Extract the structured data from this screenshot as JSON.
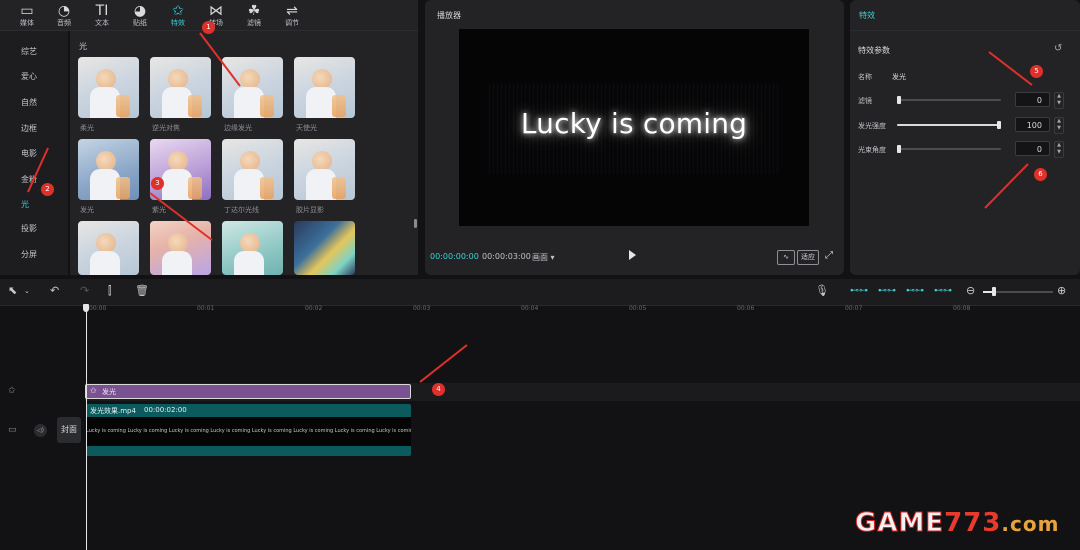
{
  "toolbar": {
    "items": [
      {
        "label": "媒体",
        "icon": "▭"
      },
      {
        "label": "音频",
        "icon": "◔"
      },
      {
        "label": "文本",
        "icon": "TI"
      },
      {
        "label": "贴纸",
        "icon": "◕"
      },
      {
        "label": "特效",
        "icon": "✩"
      },
      {
        "label": "转场",
        "icon": "⋈"
      },
      {
        "label": "滤镜",
        "icon": "☘"
      },
      {
        "label": "调节",
        "icon": "⇌"
      }
    ]
  },
  "sidebar": {
    "items": [
      "综艺",
      "爱心",
      "自然",
      "边框",
      "电影",
      "金粉",
      "光",
      "投影",
      "分屏"
    ]
  },
  "effects": {
    "section_title": "光",
    "items": [
      "柔光",
      "逆光对焦",
      "边缘发光",
      "天使光",
      "发光",
      "紫光",
      "丁达尔光线",
      "胶片显影"
    ]
  },
  "player": {
    "title": "播放器",
    "caption": "Lucky is coming",
    "current_time": "00:00:00:00",
    "total_time": "00:00:03:00",
    "ratio_label": "画面",
    "original_label": "适应"
  },
  "props": {
    "header": "特效",
    "section_title": "特效参数",
    "name_label": "名称",
    "name_value": "发光",
    "params": [
      {
        "label": "滤镜",
        "value": "0",
        "level": 0
      },
      {
        "label": "发光强度",
        "value": "100",
        "level": 1
      },
      {
        "label": "光束角度",
        "value": "0",
        "level": 0
      }
    ]
  },
  "timeline": {
    "ticks": [
      "00:00",
      "00:01",
      "00:02",
      "00:03",
      "00:04",
      "00:05",
      "00:06",
      "00:07",
      "00:08"
    ],
    "fx_clip_label": "发光",
    "video_clip_name": "发光效果.mp4",
    "video_clip_duration": "00:00:02:00",
    "video_strip_text": "Lucky is coming Lucky is coming Lucky is coming Lucky is coming Lucky is coming Lucky is coming Lucky is coming Lucky is coming Lucky is coming Lucky is coming Lucky is coming",
    "cover_label": "封面"
  },
  "annotations": [
    "1",
    "2",
    "3",
    "4",
    "5",
    "6"
  ],
  "watermark": {
    "brand": "GAME",
    "digits": "773",
    "domain": ".com"
  },
  "colors": {
    "accent": "#3bd2d6",
    "fx_clip": "#7a5291",
    "video_clip": "#0b5a5e",
    "badge": "#e0302a"
  }
}
